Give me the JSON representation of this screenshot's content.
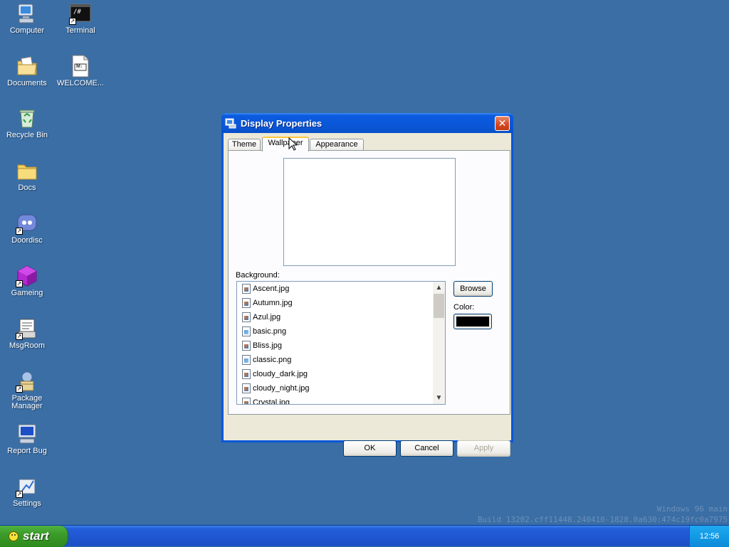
{
  "desktop": {
    "icons": [
      {
        "label": "Computer"
      },
      {
        "label": "Terminal"
      },
      {
        "label": "Documents"
      },
      {
        "label": "WELCOME..."
      },
      {
        "label": "Recycle Bin"
      },
      {
        "label": "Docs"
      },
      {
        "label": "Doordisc"
      },
      {
        "label": "Gameing"
      },
      {
        "label": "MsgRoom"
      },
      {
        "label": "Package Manager"
      },
      {
        "label": "Report Bug"
      },
      {
        "label": "Settings"
      }
    ],
    "terminal_glyph": "/#",
    "welcome_glyph": "M↓",
    "watermark_line1": "Windows 96 main",
    "watermark_line2": "Build 13202.cff11448.240410-1828.0a630:474c19fc0a7975"
  },
  "taskbar": {
    "start_label": "start",
    "clock": "12:56",
    "colors": {
      "start": "#3c9b2a",
      "bar": "#245edb",
      "tray": "#129be5"
    }
  },
  "dialog": {
    "title": "Display Properties",
    "close_glyph": "✕",
    "tabs": [
      {
        "label": "Theme"
      },
      {
        "label": "Wallpaper"
      },
      {
        "label": "Appearance"
      }
    ],
    "active_tab": "Wallpaper",
    "background_label": "Background:",
    "backgrounds": [
      {
        "name": "Ascent.jpg",
        "type": "jpg"
      },
      {
        "name": "Autumn.jpg",
        "type": "jpg"
      },
      {
        "name": "Azul.jpg",
        "type": "jpg"
      },
      {
        "name": "basic.png",
        "type": "png"
      },
      {
        "name": "Bliss.jpg",
        "type": "jpg"
      },
      {
        "name": "classic.png",
        "type": "png"
      },
      {
        "name": "cloudy_dark.jpg",
        "type": "jpg"
      },
      {
        "name": "cloudy_night.jpg",
        "type": "jpg"
      },
      {
        "name": "Crystal.jpg",
        "type": "jpg"
      }
    ],
    "browse_label": "Browse",
    "color_label": "Color:",
    "color_value": "#000000",
    "ok_label": "OK",
    "cancel_label": "Cancel",
    "apply_label": "Apply"
  }
}
